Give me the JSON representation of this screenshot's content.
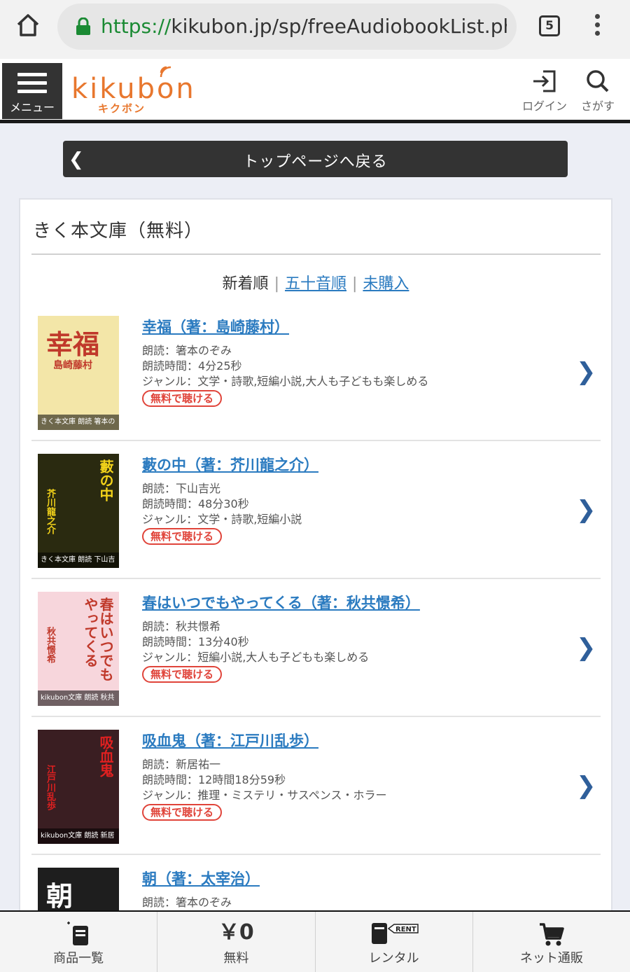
{
  "browser": {
    "url_scheme": "https://",
    "url_rest": "kikubon.jp/sp/freeAudiobookList.php?t_l",
    "tab_count": "5"
  },
  "header": {
    "menu_label": "メニュー",
    "logo_word": "kikubon",
    "logo_sub": "キクボン",
    "login_label": "ログイン",
    "search_label": "さがす"
  },
  "back_bar": {
    "label": "トップページへ戻る"
  },
  "card": {
    "title": "きく本文庫（無料）",
    "sort_tabs": {
      "active": "新着順",
      "gojuon": "五十音順",
      "unpurchased": "未購入"
    }
  },
  "items": [
    {
      "title": "幸福（著：島崎藤村）",
      "reader": "朗読：箸本のぞみ",
      "duration": "朗読時間：4分25秒",
      "genre": "ジャンル：文学・詩歌,短編小説,大人も子どもも楽しめる",
      "free_label": "無料で聴ける",
      "cover_title": "幸福",
      "cover_author": "島崎藤村",
      "cover_footer": "きく本文庫 朗読 箸本のぞみ",
      "cover_bg": "#f3e6a8",
      "cover_color": "#c0392b"
    },
    {
      "title": "藪の中（著：芥川龍之介）",
      "reader": "朗読：下山吉光",
      "duration": "朗読時間：48分30秒",
      "genre": "ジャンル：文学・詩歌,短編小説",
      "free_label": "無料で聴ける",
      "cover_title": "藪の中",
      "cover_author": "芥川龍之介",
      "cover_footer": "きく本文庫 朗読 下山吉光",
      "cover_bg": "#2a2a10",
      "cover_color": "#f2d21a"
    },
    {
      "title": "春はいつでもやってくる（著：秋共憬希）",
      "reader": "朗読：秋共憬希",
      "duration": "朗読時間：13分40秒",
      "genre": "ジャンル：短編小説,大人も子どもも楽しめる",
      "free_label": "無料で聴ける",
      "cover_title": "春はいつでもやってくる",
      "cover_author": "秋共憬希",
      "cover_footer": "kikubon文庫 朗読 秋共憬希",
      "cover_bg": "#f7d6dc",
      "cover_color": "#c0392b"
    },
    {
      "title": "吸血鬼（著：江戸川乱歩）",
      "reader": "朗読：新居祐一",
      "duration": "朗読時間：12時間18分59秒",
      "genre": "ジャンル：推理・ミステリ・サスペンス・ホラー",
      "free_label": "無料で聴ける",
      "cover_title": "吸血鬼",
      "cover_author": "江戸川乱歩",
      "cover_footer": "kikubon文庫 朗読 新居祐一",
      "cover_bg": "#3a1e22",
      "cover_color": "#e02020"
    },
    {
      "title": "朝（著：太宰治）",
      "reader": "朗読：箸本のぞみ",
      "duration": "",
      "genre": "",
      "free_label": "",
      "cover_title": "朝",
      "cover_author": "",
      "cover_footer": "",
      "cover_bg": "#1e1e1e",
      "cover_color": "#ffffff"
    }
  ],
  "bottom_nav": [
    {
      "label": "商品一覧",
      "icon": "book-list-icon"
    },
    {
      "label": "無料",
      "icon_text": "￥0"
    },
    {
      "label": "レンタル",
      "icon": "rent-icon",
      "icon_text": "RENT"
    },
    {
      "label": "ネット通販",
      "icon": "cart-icon"
    }
  ]
}
